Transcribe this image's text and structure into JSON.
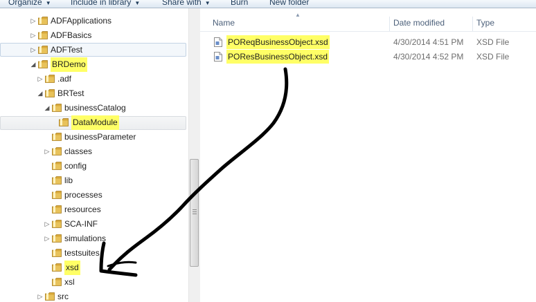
{
  "toolbar": {
    "organize": "Organize",
    "include_in_library": "Include in library",
    "share_with": "Share with",
    "burn": "Burn",
    "new_folder": "New folder"
  },
  "tree": [
    {
      "label": "ADFApplications",
      "expander": "collapsed",
      "highlight": false
    },
    {
      "label": "ADFBasics",
      "expander": "collapsed",
      "highlight": false
    },
    {
      "label": "ADFTest",
      "expander": "collapsed",
      "highlight": false
    },
    {
      "label": "BRDemo",
      "expander": "expanded",
      "highlight": true
    },
    {
      "label": ".adf",
      "expander": "collapsed",
      "highlight": false
    },
    {
      "label": "BRTest",
      "expander": "expanded",
      "highlight": false
    },
    {
      "label": "businessCatalog",
      "expander": "expanded",
      "highlight": false
    },
    {
      "label": "DataModule",
      "expander": "none",
      "highlight": true
    },
    {
      "label": "businessParameter",
      "expander": "none",
      "highlight": false
    },
    {
      "label": "classes",
      "expander": "collapsed",
      "highlight": false
    },
    {
      "label": "config",
      "expander": "none",
      "highlight": false
    },
    {
      "label": "lib",
      "expander": "none",
      "highlight": false
    },
    {
      "label": "processes",
      "expander": "none",
      "highlight": false
    },
    {
      "label": "resources",
      "expander": "none",
      "highlight": false
    },
    {
      "label": "SCA-INF",
      "expander": "collapsed",
      "highlight": false
    },
    {
      "label": "simulations",
      "expander": "collapsed",
      "highlight": false
    },
    {
      "label": "testsuites",
      "expander": "none",
      "highlight": false
    },
    {
      "label": "xsd",
      "expander": "none",
      "highlight": true
    },
    {
      "label": "xsl",
      "expander": "none",
      "highlight": false
    },
    {
      "label": "src",
      "expander": "collapsed",
      "highlight": false
    }
  ],
  "columns": {
    "name": "Name",
    "date_modified": "Date modified",
    "type": "Type"
  },
  "files": [
    {
      "name": "POReqBusinessObject.xsd",
      "date": "4/30/2014 4:51 PM",
      "type": "XSD File"
    },
    {
      "name": "POResBusinessObject.xsd",
      "date": "4/30/2014 4:52 PM",
      "type": "XSD File"
    }
  ],
  "colors": {
    "highlight": "#ffff66",
    "folder": "#e8c25a",
    "header_text": "#4c607a",
    "toolbar_text": "#1e3b5a"
  }
}
